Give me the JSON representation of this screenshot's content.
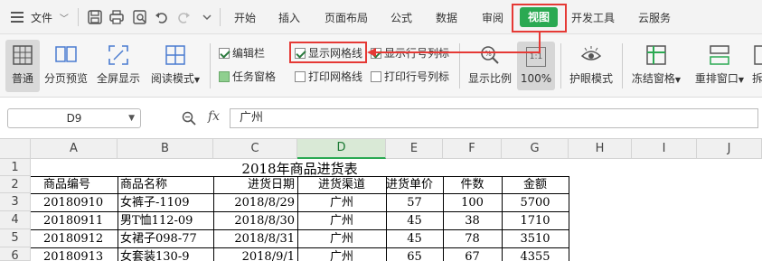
{
  "menubar": {
    "file_label": "文件",
    "tabs": [
      "开始",
      "插入",
      "页面布局",
      "公式",
      "数据",
      "审阅",
      "视图",
      "开发工具",
      "云服务"
    ],
    "active_tab": "视图"
  },
  "ribbon": {
    "normal": "普通",
    "page_preview": "分页预览",
    "fullscreen": "全屏显示",
    "reading_mode": "阅读模式",
    "edit_bar": "编辑栏",
    "show_gridlines": "显示网格线",
    "show_row_col_headers": "显示行号列标",
    "task_pane": "任务窗格",
    "print_gridlines": "打印网格线",
    "print_row_col_headers": "打印行号列标",
    "zoom_ratio": "显示比例",
    "zoom_value": "100%",
    "eye_mode": "护眼模式",
    "freeze_panes": "冻结窗格",
    "arrange_windows": "重排窗口",
    "more": "拆"
  },
  "formula_bar": {
    "cell_ref": "D9",
    "fx": "fx",
    "value": "广州"
  },
  "grid": {
    "columns": [
      "A",
      "B",
      "C",
      "D",
      "E",
      "F",
      "G",
      "H",
      "I",
      "J"
    ],
    "rows": [
      "1",
      "2",
      "3",
      "4",
      "5",
      "6"
    ],
    "title": "2018年商品进货表",
    "headers": [
      "商品编号",
      "商品名称",
      "进货日期",
      "进货渠道",
      "进货单价",
      "件数",
      "金额"
    ],
    "data": [
      [
        "20180910",
        "女裤子-1109",
        "2018/8/29",
        "广州",
        "57",
        "100",
        "5700"
      ],
      [
        "20180911",
        "男T恤112-09",
        "2018/8/30",
        "广州",
        "45",
        "38",
        "1710"
      ],
      [
        "20180912",
        "女裙子098-77",
        "2018/8/31",
        "广州",
        "45",
        "78",
        "3510"
      ],
      [
        "20180913",
        "女套装130-9",
        "2018/9/1",
        "广州",
        "65",
        "67",
        "4355"
      ]
    ]
  },
  "colors": {
    "accent": "#2aa952",
    "annotation": "#e53935"
  }
}
